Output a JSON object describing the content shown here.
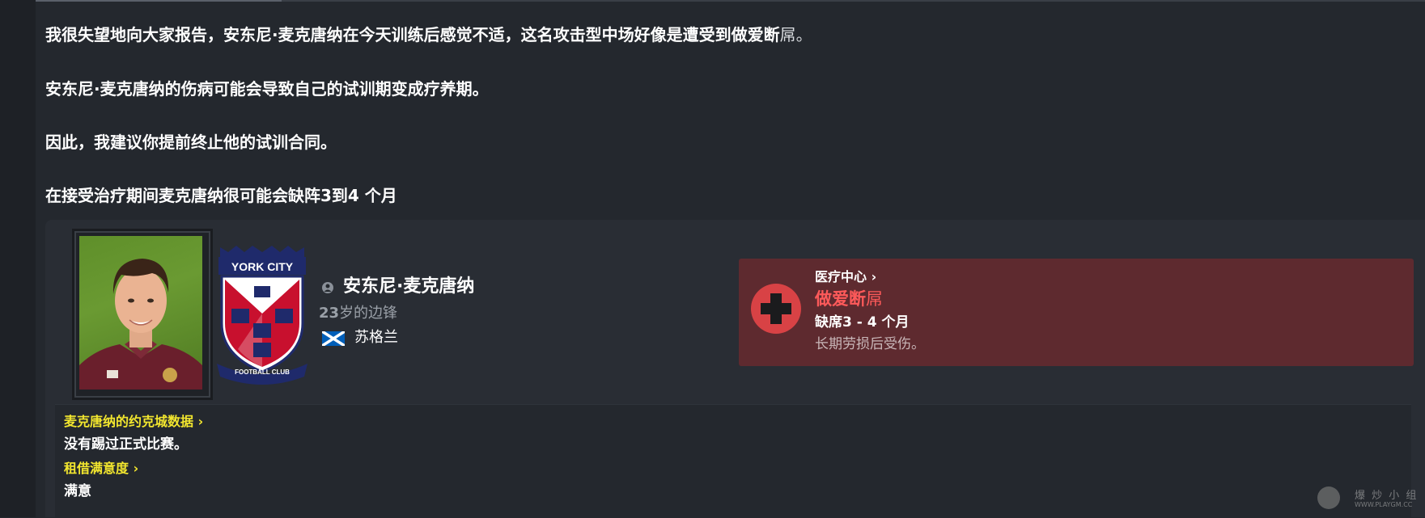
{
  "message": {
    "line1_main": "我很失望地向大家报告，安东尼·麦克唐纳在今天训练后感觉不适，这名攻击型中场好像是遭受到做爱断",
    "line1_tail": "屌。",
    "line2": "安东尼·麦克唐纳的伤病可能会导致自己的试训期变成疗养期。",
    "line3": "因此，我建议你提前终止他的试训合同。",
    "line4": "在接受治疗期间麦克唐纳很可能会缺阵3到4 个月"
  },
  "player": {
    "name": "安东尼·麦克唐纳",
    "age_number": "23",
    "age_role": "岁的边锋",
    "nationality": "苏格兰",
    "club_crest_text": {
      "top": "YORK CITY",
      "bottom": "FOOTBALL CLUB"
    }
  },
  "injury": {
    "link": "医疗中心 ›",
    "name_main": "做爱断",
    "name_tail": "屌",
    "duration": "缺席3 - 4 个月",
    "description": "长期劳损后受伤。"
  },
  "stats": {
    "york_link": "麦克唐纳的约克城数据 ›",
    "york_value": "没有踢过正式比赛。",
    "loan_link": "租借满意度 ›",
    "loan_value": "满意"
  },
  "watermark": {
    "text": "爆 炒 小 组",
    "url": "WWW.PLAYGM.CC"
  },
  "colors": {
    "background": "#24282e",
    "injury_box": "#5e2a2f",
    "injury_red": "#ff5a5a",
    "link_yellow": "#f2e62e"
  }
}
